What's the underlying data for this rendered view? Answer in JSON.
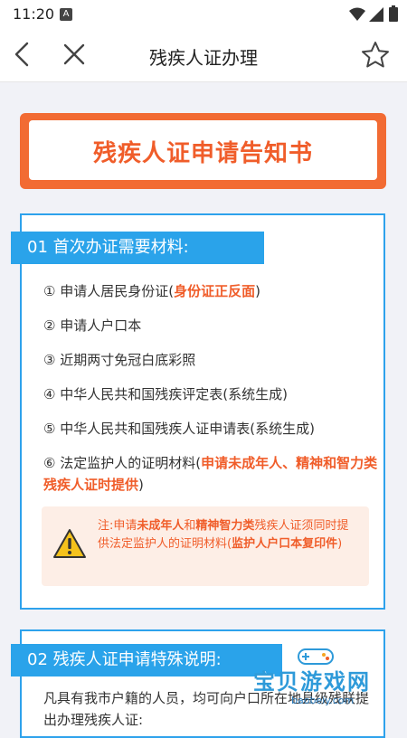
{
  "status_bar": {
    "time": "11:20",
    "notification_glyph": "A"
  },
  "nav": {
    "title": "残疾人证办理"
  },
  "banner": {
    "heading": "残疾人证申请告知书"
  },
  "section1": {
    "tag": "01 首次办证需要材料:",
    "items": [
      {
        "index": "①",
        "text": "申请人居民身份证(",
        "highlight": "身份证正反面",
        "tail": ")"
      },
      {
        "index": "②",
        "text": "申请人户口本"
      },
      {
        "index": "③",
        "text": "近期两寸免冠白底彩照"
      },
      {
        "index": "④",
        "text": "中华人民共和国残疾评定表(系统生成)"
      },
      {
        "index": "⑤",
        "text": "中华人民共和国残疾人证申请表(系统生成)"
      },
      {
        "index": "⑥",
        "text": "法定监护人的证明材料(",
        "highlight": "申请未成年人、精神和智力类残疾人证时提供",
        "tail": ")"
      }
    ],
    "warning": {
      "p1": "注:申请",
      "b1": "未成年人",
      "p2": "和",
      "b2": "精神智力类",
      "p3": "残疾人证须同时提供法定监护人的证明材料(",
      "b3": "监护人户口本复印件",
      "p4": ")"
    }
  },
  "section2": {
    "tag": "02 残疾人证申请特殊说明:",
    "body": "凡具有我市户籍的人员，均可向户口所在地县级残联提出办理残疾人证:"
  },
  "watermark": {
    "text": "宝贝游戏网",
    "url": "baobeiy.com"
  },
  "colors": {
    "accent_orange": "#f05d2a",
    "accent_blue": "#2aa3ea",
    "warning_bg": "#fdeee6"
  }
}
